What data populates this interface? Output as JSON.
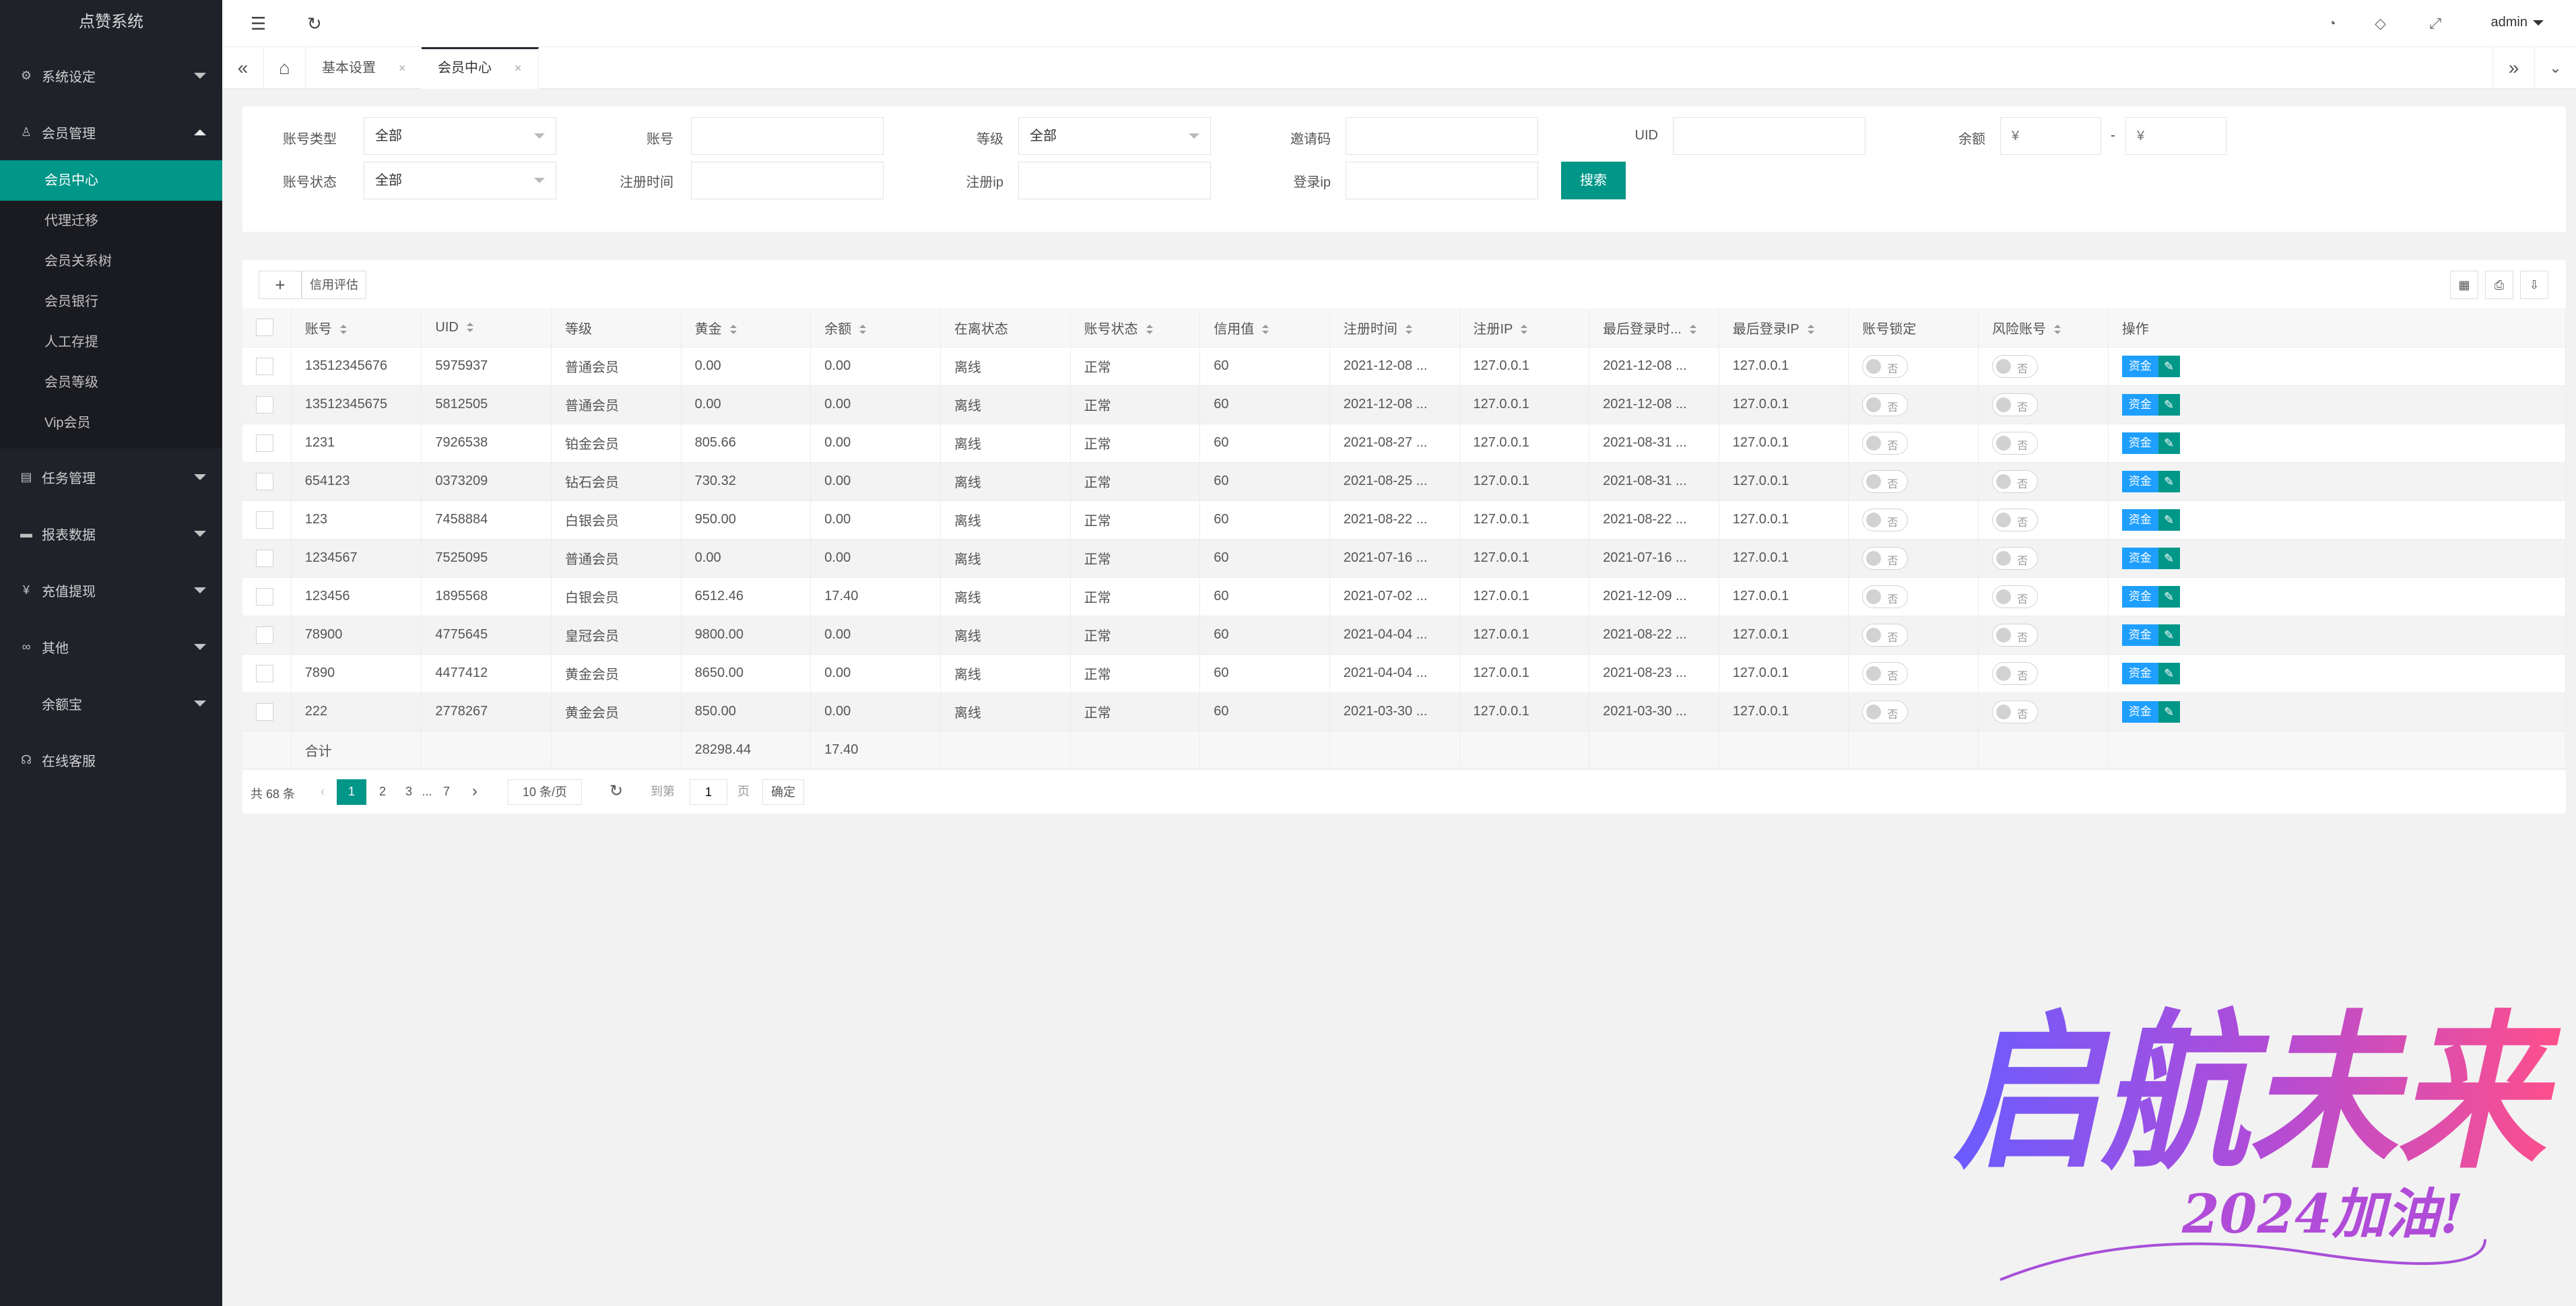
{
  "app": {
    "title": "点赞系统"
  },
  "sidebar": {
    "groups": [
      {
        "label": "系统设定",
        "icon": "gear-icon",
        "expanded": false
      },
      {
        "label": "会员管理",
        "icon": "user-icon",
        "expanded": true,
        "items": [
          "会员中心",
          "代理迁移",
          "会员关系树",
          "会员银行",
          "人工存提",
          "会员等级",
          "Vip会员"
        ],
        "active": "会员中心"
      },
      {
        "label": "任务管理",
        "icon": "calendar-icon",
        "expanded": false
      },
      {
        "label": "报表数据",
        "icon": "chat-icon",
        "expanded": false
      },
      {
        "label": "充值提现",
        "icon": "yen-icon",
        "expanded": false
      },
      {
        "label": "其他",
        "icon": "link-icon",
        "expanded": false
      },
      {
        "label": "余额宝",
        "icon": "",
        "expanded": false
      },
      {
        "label": "在线客服",
        "icon": "headset-icon",
        "expanded": false
      }
    ]
  },
  "header": {
    "user": "admin"
  },
  "tabs": [
    {
      "label": "基本设置"
    },
    {
      "label": "会员中心",
      "active": true
    }
  ],
  "filters": {
    "account_type": {
      "label": "账号类型",
      "value": "全部"
    },
    "account": {
      "label": "账号",
      "value": ""
    },
    "level": {
      "label": "等级",
      "value": "全部"
    },
    "invite_code": {
      "label": "邀请码",
      "value": ""
    },
    "uid": {
      "label": "UID",
      "value": ""
    },
    "balance": {
      "label": "余额",
      "min_placeholder": "¥",
      "max_placeholder": "¥",
      "separator": "-"
    },
    "account_status": {
      "label": "账号状态",
      "value": "全部"
    },
    "reg_time": {
      "label": "注册时间",
      "value": ""
    },
    "reg_ip": {
      "label": "注册ip",
      "value": ""
    },
    "login_ip": {
      "label": "登录ip",
      "value": ""
    },
    "search_label": "搜索"
  },
  "table": {
    "toolbar": {
      "credit_label": "信用评估"
    },
    "columns": [
      "账号",
      "UID",
      "等级",
      "黄金",
      "余额",
      "在离状态",
      "账号状态",
      "信用值",
      "注册时间",
      "注册IP",
      "最后登录时...",
      "最后登录IP",
      "账号锁定",
      "风险账号",
      "操作"
    ],
    "rows": [
      [
        "13512345676",
        "5975937",
        "普通会员",
        "0.00",
        "0.00",
        "离线",
        "正常",
        "60",
        "2021-12-08 ...",
        "127.0.0.1",
        "2021-12-08 ...",
        "127.0.0.1"
      ],
      [
        "13512345675",
        "5812505",
        "普通会员",
        "0.00",
        "0.00",
        "离线",
        "正常",
        "60",
        "2021-12-08 ...",
        "127.0.0.1",
        "2021-12-08 ...",
        "127.0.0.1"
      ],
      [
        "1231",
        "7926538",
        "铂金会员",
        "805.66",
        "0.00",
        "离线",
        "正常",
        "60",
        "2021-08-27 ...",
        "127.0.0.1",
        "2021-08-31 ...",
        "127.0.0.1"
      ],
      [
        "654123",
        "0373209",
        "钻石会员",
        "730.32",
        "0.00",
        "离线",
        "正常",
        "60",
        "2021-08-25 ...",
        "127.0.0.1",
        "2021-08-31 ...",
        "127.0.0.1"
      ],
      [
        "123",
        "7458884",
        "白银会员",
        "950.00",
        "0.00",
        "离线",
        "正常",
        "60",
        "2021-08-22 ...",
        "127.0.0.1",
        "2021-08-22 ...",
        "127.0.0.1"
      ],
      [
        "1234567",
        "7525095",
        "普通会员",
        "0.00",
        "0.00",
        "离线",
        "正常",
        "60",
        "2021-07-16 ...",
        "127.0.0.1",
        "2021-07-16 ...",
        "127.0.0.1"
      ],
      [
        "123456",
        "1895568",
        "白银会员",
        "6512.46",
        "17.40",
        "离线",
        "正常",
        "60",
        "2021-07-02 ...",
        "127.0.0.1",
        "2021-12-09 ...",
        "127.0.0.1"
      ],
      [
        "78900",
        "4775645",
        "皇冠会员",
        "9800.00",
        "0.00",
        "离线",
        "正常",
        "60",
        "2021-04-04 ...",
        "127.0.0.1",
        "2021-08-22 ...",
        "127.0.0.1"
      ],
      [
        "7890",
        "4477412",
        "黄金会员",
        "8650.00",
        "0.00",
        "离线",
        "正常",
        "60",
        "2021-04-04 ...",
        "127.0.0.1",
        "2021-08-23 ...",
        "127.0.0.1"
      ],
      [
        "222",
        "2778267",
        "黄金会员",
        "850.00",
        "0.00",
        "离线",
        "正常",
        "60",
        "2021-03-30 ...",
        "127.0.0.1",
        "2021-03-30 ...",
        "127.0.0.1"
      ]
    ],
    "switch_off_label": "否",
    "fund_label": "资金",
    "summary": {
      "label": "合计",
      "gold": "28298.44",
      "balance": "17.40"
    }
  },
  "pager": {
    "total": "共 68 条",
    "pages": [
      "1",
      "2",
      "3",
      "...",
      "7"
    ],
    "current": "1",
    "page_size": "10 条/页",
    "goto_label": "到第",
    "goto_value": "1",
    "page_unit": "页",
    "confirm": "确定"
  },
  "watermark": {
    "main": "启航未来",
    "sub": "2024加油!"
  },
  "colors": {
    "primary": "#009688",
    "sidebar": "#20222a",
    "fund": "#1e9fff"
  }
}
